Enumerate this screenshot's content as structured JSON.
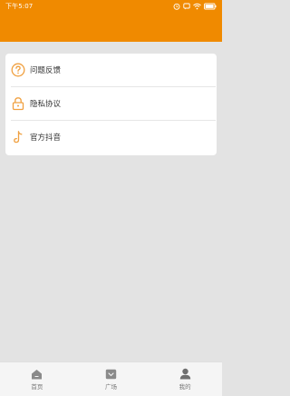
{
  "status_bar": {
    "time": "下午5:07",
    "icons": [
      "alarm-icon",
      "message-icon",
      "wifi-icon",
      "battery-icon"
    ]
  },
  "menu": {
    "items": [
      {
        "label": "问题反馈",
        "icon": "question-icon"
      },
      {
        "label": "隐私协议",
        "icon": "lock-icon"
      },
      {
        "label": "官方抖音",
        "icon": "tiktok-icon"
      }
    ]
  },
  "tabbar": {
    "tabs": [
      {
        "label": "首页",
        "icon": "home-icon"
      },
      {
        "label": "广场",
        "icon": "plaza-icon"
      },
      {
        "label": "我的",
        "icon": "profile-icon"
      }
    ]
  },
  "colors": {
    "accent": "#f08a00",
    "background": "#e3e3e3",
    "card": "#ffffff",
    "icon_orange": "#f0a040"
  }
}
